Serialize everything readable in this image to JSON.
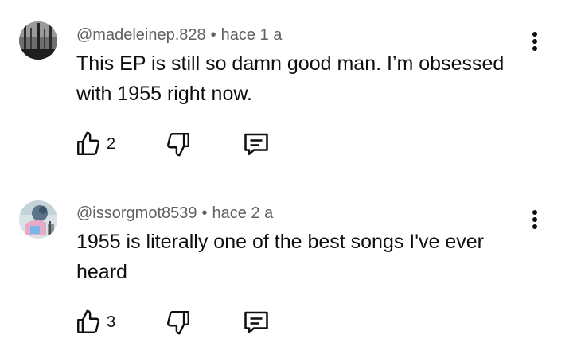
{
  "comments": [
    {
      "author": "@madeleinep.828",
      "separator": "•",
      "time": "hace 1 a",
      "text": "This EP is still so damn good man. I’m obsessed with 1955 right now.",
      "like_count": "2",
      "avatar_icon": "avatar-forest-photo"
    },
    {
      "author": "@issorgmot8539",
      "separator": "•",
      "time": "hace 2 a",
      "text": "1955 is literally one of the best songs I've ever heard",
      "like_count": "3",
      "avatar_icon": "avatar-anime-photo"
    }
  ],
  "icons": {
    "like": "thumbs-up-icon",
    "dislike": "thumbs-down-icon",
    "reply": "reply-comment-icon",
    "more": "more-vertical-icon"
  }
}
